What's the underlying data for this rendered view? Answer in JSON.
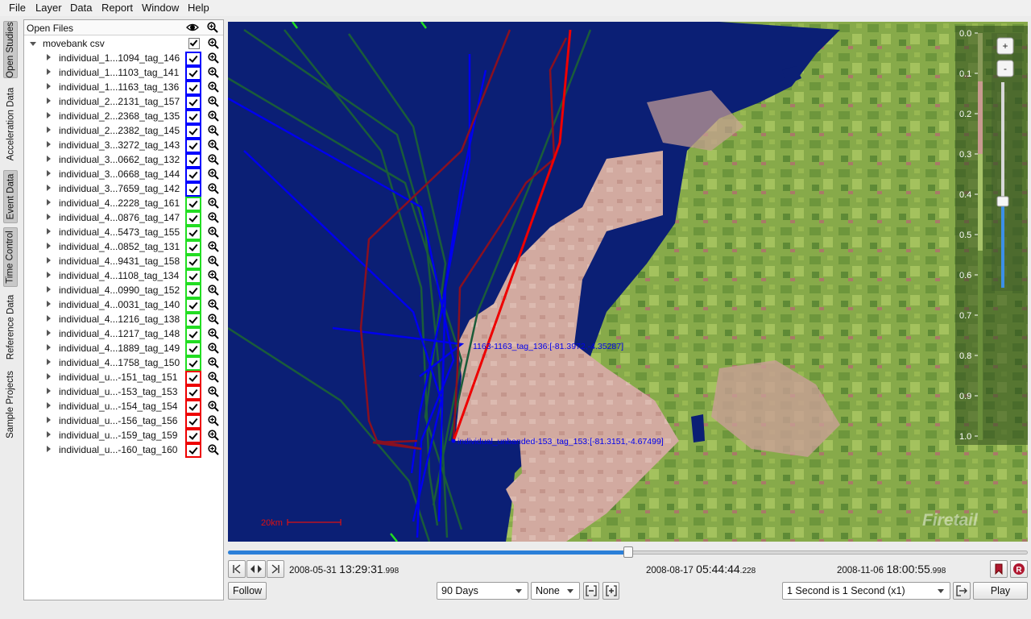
{
  "menu": [
    "File",
    "Layer",
    "Data",
    "Report",
    "Window",
    "Help"
  ],
  "side_tabs": [
    "Open Studies",
    "Acceleration Data",
    "Event Data",
    "Time Control",
    "Reference Data",
    "Sample Projects"
  ],
  "tree": {
    "header": "Open Files",
    "root": "movebank csv",
    "items": [
      {
        "label": "individual_1...1094_tag_146",
        "color": "#0000ff"
      },
      {
        "label": "individual_1...1103_tag_141",
        "color": "#0000ff"
      },
      {
        "label": "individual_1...1163_tag_136",
        "color": "#0000ff"
      },
      {
        "label": "individual_2...2131_tag_157",
        "color": "#0000ff"
      },
      {
        "label": "individual_2...2368_tag_135",
        "color": "#0000ff"
      },
      {
        "label": "individual_2...2382_tag_145",
        "color": "#0000ff"
      },
      {
        "label": "individual_3...3272_tag_143",
        "color": "#0000ff"
      },
      {
        "label": "individual_3...0662_tag_132",
        "color": "#0000ff"
      },
      {
        "label": "individual_3...0668_tag_144",
        "color": "#0000ff"
      },
      {
        "label": "individual_3...7659_tag_142",
        "color": "#0000ff"
      },
      {
        "label": "individual_4...2228_tag_161",
        "color": "#22dd22"
      },
      {
        "label": "individual_4...0876_tag_147",
        "color": "#22dd22"
      },
      {
        "label": "individual_4...5473_tag_155",
        "color": "#22dd22"
      },
      {
        "label": "individual_4...0852_tag_131",
        "color": "#22dd22"
      },
      {
        "label": "individual_4...9431_tag_158",
        "color": "#22dd22"
      },
      {
        "label": "individual_4...1108_tag_134",
        "color": "#22dd22"
      },
      {
        "label": "individual_4...0990_tag_152",
        "color": "#22dd22"
      },
      {
        "label": "individual_4...0031_tag_140",
        "color": "#22dd22"
      },
      {
        "label": "individual_4...1216_tag_138",
        "color": "#22dd22"
      },
      {
        "label": "individual_4...1217_tag_148",
        "color": "#22dd22"
      },
      {
        "label": "individual_4...1889_tag_149",
        "color": "#22dd22"
      },
      {
        "label": "individual_4...1758_tag_150",
        "color": "#22dd22"
      },
      {
        "label": "individual_u...-151_tag_151",
        "color": "#ee0000"
      },
      {
        "label": "individual_u...-153_tag_153",
        "color": "#ee0000"
      },
      {
        "label": "individual_u...-154_tag_154",
        "color": "#ee0000"
      },
      {
        "label": "individual_u...-156_tag_156",
        "color": "#ee0000"
      },
      {
        "label": "individual_u...-159_tag_159",
        "color": "#ee0000"
      },
      {
        "label": "individual_u...-160_tag_160",
        "color": "#ee0000"
      }
    ]
  },
  "map": {
    "annotation_1": "1163-1163_tag_136:[-81.3972,-4.35287]",
    "annotation_2": "individual_unbanded-153_tag_153:[-81.3151,-4.67499]",
    "scale_label": "20km",
    "watermark": "Firetail",
    "zoom_in": "+",
    "zoom_out": "-",
    "zoom_level_fraction": 0.42,
    "legend_ticks": [
      "0.0",
      "0.1",
      "0.2",
      "0.3",
      "0.4",
      "0.5",
      "0.6",
      "0.7",
      "0.8",
      "0.9",
      "1.0"
    ]
  },
  "timeline": {
    "position_fraction": 0.5,
    "start": {
      "date": "2008-05-31",
      "time": "13:29:31",
      "ms": ".998"
    },
    "current": {
      "date": "2008-08-17",
      "time": "05:44:44",
      "ms": ".228"
    },
    "end": {
      "date": "2008-11-06",
      "time": "18:00:55",
      "ms": ".998"
    }
  },
  "controls": {
    "follow": "Follow",
    "window_select": "90 Days",
    "mode_select": "None",
    "speed_select": "1 Second is 1 Second (x1)",
    "play": "Play",
    "record": "R"
  }
}
